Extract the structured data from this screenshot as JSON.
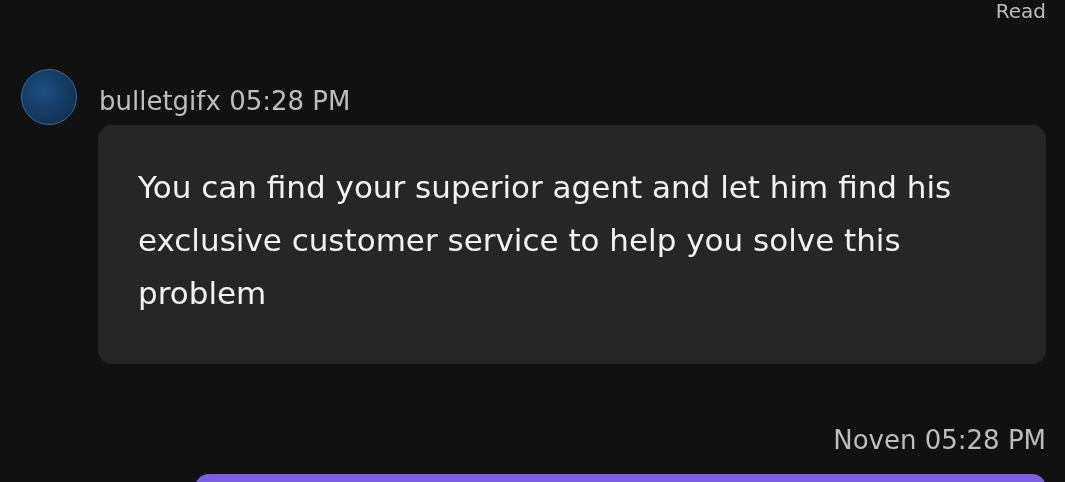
{
  "read_receipt": "Read",
  "messages": [
    {
      "sender": "bulletgifx",
      "time": "05:28 PM",
      "outgoing": false,
      "text": "You can find your superior agent and let him find his exclusive customer service to help you solve this problem"
    },
    {
      "sender": "Noven",
      "time": "05:28 PM",
      "outgoing": true
    }
  ]
}
